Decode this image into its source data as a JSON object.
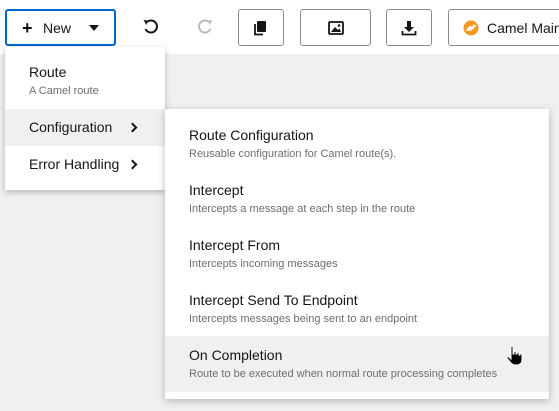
{
  "toolbar": {
    "new_label": "New",
    "camel_label": "Camel Main",
    "icons": [
      "plus-icon",
      "caret-down-icon",
      "undo-icon",
      "redo-icon",
      "copy-icon",
      "image-icon",
      "download-icon",
      "camel-logo-icon"
    ],
    "accent_color": "#0066cc"
  },
  "menu": {
    "items": [
      {
        "label": "Route",
        "description": "A Camel route"
      },
      {
        "label": "Configuration",
        "has_submenu": true,
        "active": true
      },
      {
        "label": "Error Handling",
        "has_submenu": true
      }
    ]
  },
  "submenu": {
    "items": [
      {
        "label": "Route Configuration",
        "description": "Reusable configuration for Camel route(s)."
      },
      {
        "label": "Intercept",
        "description": "Intercepts a message at each step in the route"
      },
      {
        "label": "Intercept From",
        "description": "Intercepts incoming messages"
      },
      {
        "label": "Intercept Send To Endpoint",
        "description": "Intercepts messages being sent to an endpoint"
      },
      {
        "label": "On Completion",
        "description": "Route to be executed when normal route processing completes",
        "hovered": true
      }
    ]
  }
}
